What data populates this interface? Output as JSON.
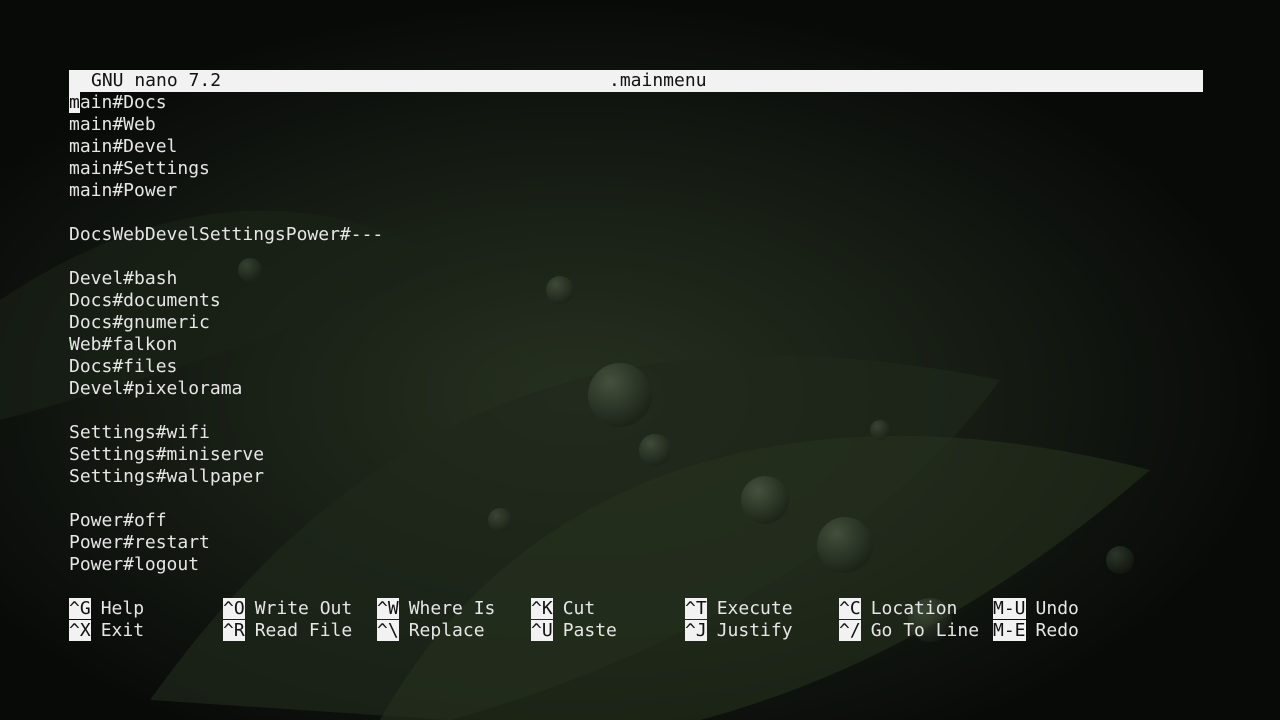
{
  "titlebar": {
    "program": "GNU nano 7.2",
    "filename": ".mainmenu"
  },
  "buffer": {
    "cursor_char": "m",
    "first_line_rest": "ain#Docs",
    "lines": [
      "main#Docs",
      "main#Web",
      "main#Devel",
      "main#Settings",
      "main#Power",
      "",
      "DocsWebDevelSettingsPower#---",
      "",
      "Devel#bash",
      "Docs#documents",
      "Docs#gnumeric",
      "Web#falkon",
      "Docs#files",
      "Devel#pixelorama",
      "",
      "Settings#wifi",
      "Settings#miniserve",
      "Settings#wallpaper",
      "",
      "Power#off",
      "Power#restart",
      "Power#logout"
    ]
  },
  "shortcuts": [
    {
      "key": "^G",
      "label": "Help"
    },
    {
      "key": "^X",
      "label": "Exit"
    },
    {
      "key": "^O",
      "label": "Write Out"
    },
    {
      "key": "^R",
      "label": "Read File"
    },
    {
      "key": "^W",
      "label": "Where Is"
    },
    {
      "key": "^\\",
      "label": "Replace"
    },
    {
      "key": "^K",
      "label": "Cut"
    },
    {
      "key": "^U",
      "label": "Paste"
    },
    {
      "key": "^T",
      "label": "Execute"
    },
    {
      "key": "^J",
      "label": "Justify"
    },
    {
      "key": "^C",
      "label": "Location"
    },
    {
      "key": "^/",
      "label": "Go To Line"
    },
    {
      "key": "M-U",
      "label": "Undo"
    },
    {
      "key": "M-E",
      "label": "Redo"
    }
  ],
  "colors": {
    "bar_background": "#f2f2f2",
    "text": "#e6e6e6",
    "wallpaper_dark": "#0b0e0b",
    "wallpaper_leaf": "#2b3a2a"
  }
}
